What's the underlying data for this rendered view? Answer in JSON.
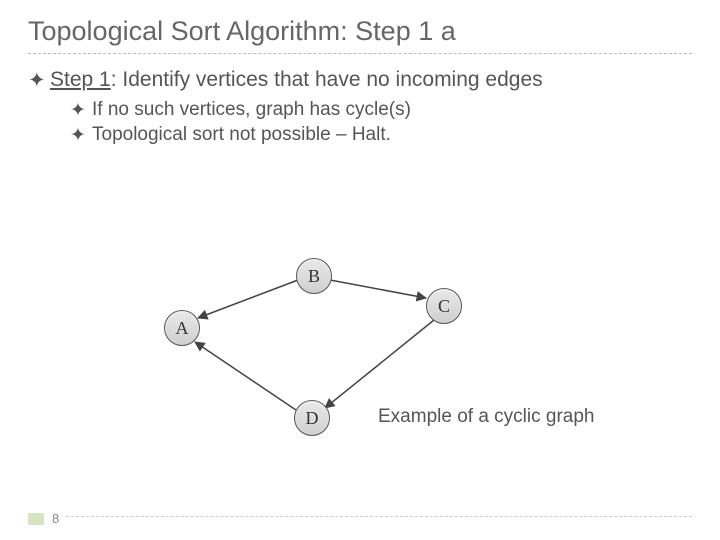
{
  "title": "Topological Sort Algorithm: Step 1 a",
  "step": {
    "label": "Step 1",
    "text": ": Identify vertices that have no incoming edges"
  },
  "sub": [
    "If no such vertices, graph has cycle(s)",
    "Topological sort not possible – Halt."
  ],
  "nodes": {
    "A": "A",
    "B": "B",
    "C": "C",
    "D": "D"
  },
  "caption": "Example of a cyclic graph",
  "page": "8",
  "bullet_glyph": "✦"
}
